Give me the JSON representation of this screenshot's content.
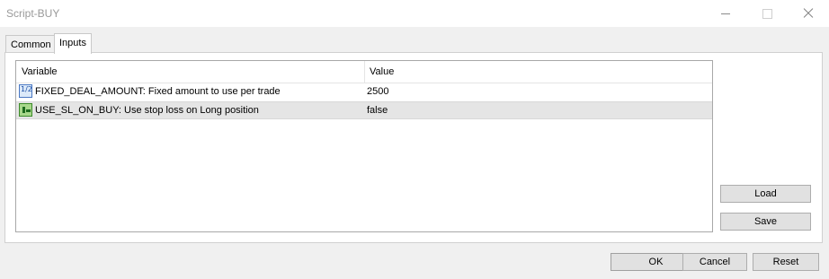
{
  "window": {
    "title": "Script-BUY"
  },
  "tabs": [
    {
      "label": "Common",
      "active": false
    },
    {
      "label": "Inputs",
      "active": true
    }
  ],
  "grid": {
    "columns": [
      "Variable",
      "Value"
    ],
    "rows": [
      {
        "icon": "integer-param-icon",
        "variable": "FIXED_DEAL_AMOUNT: Fixed amount to use per trade",
        "value": "2500",
        "selected": false
      },
      {
        "icon": "boolean-param-icon",
        "variable": "USE_SL_ON_BUY: Use stop loss on Long position",
        "value": "false",
        "selected": true
      }
    ]
  },
  "side_buttons": {
    "load": "Load",
    "save": "Save"
  },
  "footer_buttons": {
    "ok": "OK",
    "cancel": "Cancel",
    "reset": "Reset"
  },
  "colors": {
    "selection": "#e5e5e5",
    "button_face": "#e1e1e1",
    "window_bg": "#f0f0f0"
  }
}
